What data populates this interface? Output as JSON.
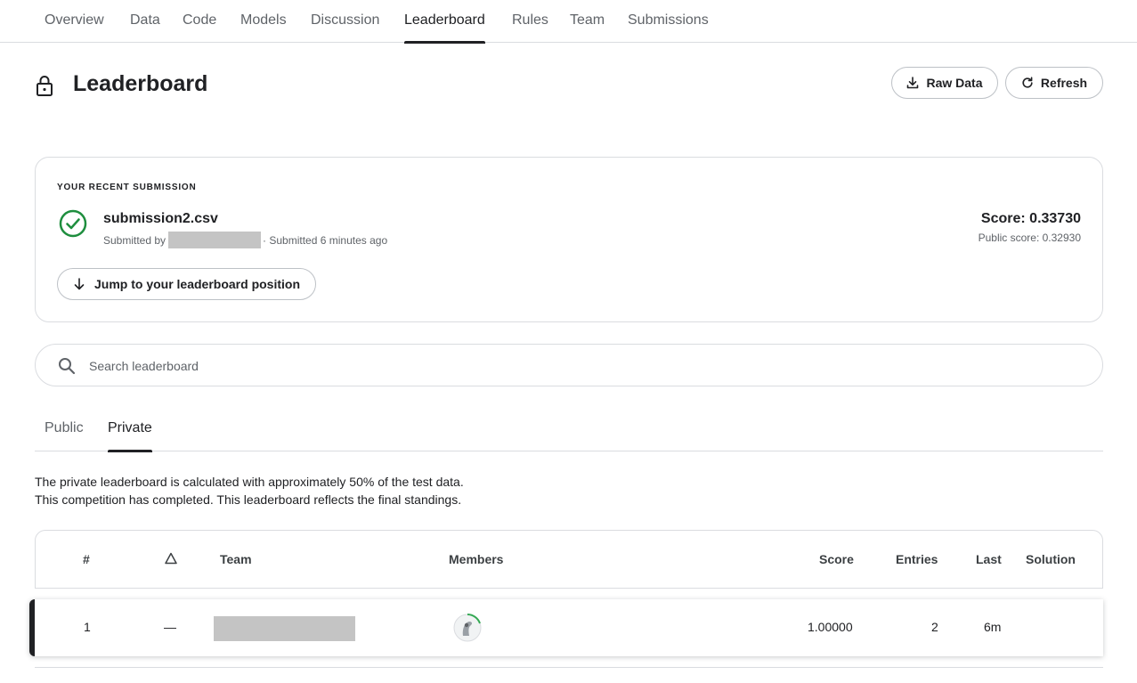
{
  "nav": {
    "tabs": [
      {
        "label": "Overview"
      },
      {
        "label": "Data"
      },
      {
        "label": "Code"
      },
      {
        "label": "Models"
      },
      {
        "label": "Discussion"
      },
      {
        "label": "Leaderboard"
      },
      {
        "label": "Rules"
      },
      {
        "label": "Team"
      },
      {
        "label": "Submissions"
      }
    ],
    "active": "Leaderboard"
  },
  "header": {
    "title": "Leaderboard",
    "icon": "lock-icon",
    "raw_data_label": "Raw Data",
    "refresh_label": "Refresh"
  },
  "recent_submission": {
    "heading": "YOUR RECENT SUBMISSION",
    "status_icon": "check-circle-icon",
    "file_name": "submission2.csv",
    "submitted_by_label": "Submitted by",
    "submitted_time": "· Submitted 6 minutes ago",
    "score": "Score: 0.33730",
    "public_score": "Public score: 0.32930",
    "jump_label": "Jump to your leaderboard position"
  },
  "search": {
    "placeholder": "Search leaderboard"
  },
  "leaderboard_tabs": {
    "tabs": [
      {
        "label": "Public"
      },
      {
        "label": "Private"
      }
    ],
    "active": "Private"
  },
  "info": {
    "line1": "The private leaderboard is calculated with approximately 50% of the test data.",
    "line2": "This competition has completed. This leaderboard reflects the final standings."
  },
  "table": {
    "headers": {
      "rank": "#",
      "delta": "△",
      "team": "Team",
      "members": "Members",
      "score": "Score",
      "entries": "Entries",
      "last": "Last",
      "solution": "Solution"
    },
    "rows": [
      {
        "rank": "1",
        "delta": "—",
        "score": "1.00000",
        "entries": "2",
        "last": "6m",
        "solution": ""
      }
    ]
  },
  "colors": {
    "accent": "#202124",
    "success": "#1e8e3e",
    "border": "#dadce0",
    "muted": "#5f6368",
    "redaction": "#c4c4c4"
  }
}
